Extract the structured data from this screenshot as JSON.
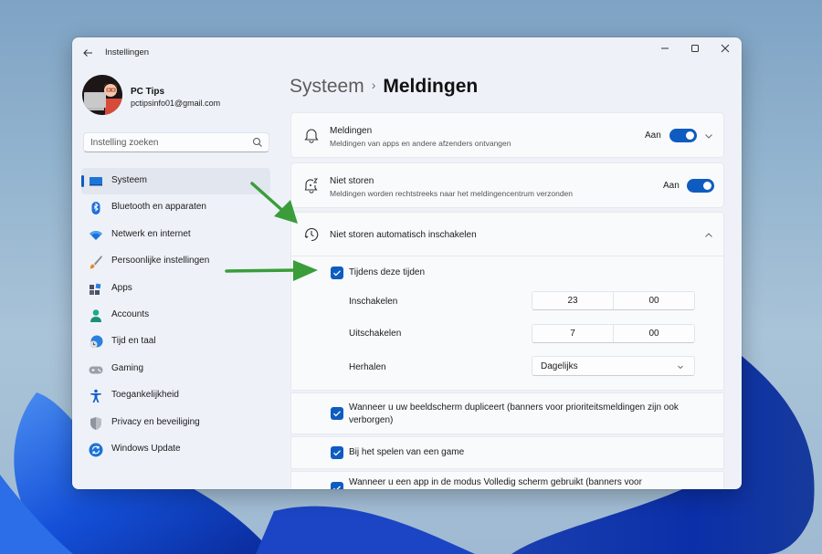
{
  "window": {
    "app_title": "Instellingen",
    "back_icon": "arrow-left-icon",
    "controls": {
      "minimize_icon": "minimize-icon",
      "maximize_icon": "maximize-icon",
      "close_icon": "close-icon"
    }
  },
  "profile": {
    "name": "PC Tips",
    "email": "pctipsinfo01@gmail.com"
  },
  "search": {
    "placeholder": "Instelling zoeken",
    "value": ""
  },
  "sidebar": {
    "items": [
      {
        "label": "Systeem",
        "icon": "monitor-icon",
        "active": true
      },
      {
        "label": "Bluetooth en apparaten",
        "icon": "bluetooth-icon",
        "active": false
      },
      {
        "label": "Netwerk en internet",
        "icon": "wifi-icon",
        "active": false
      },
      {
        "label": "Persoonlijke instellingen",
        "icon": "paintbrush-icon",
        "active": false
      },
      {
        "label": "Apps",
        "icon": "apps-icon",
        "active": false
      },
      {
        "label": "Accounts",
        "icon": "person-icon",
        "active": false
      },
      {
        "label": "Tijd en taal",
        "icon": "globe-clock-icon",
        "active": false
      },
      {
        "label": "Gaming",
        "icon": "gamepad-icon",
        "active": false
      },
      {
        "label": "Toegankelijkheid",
        "icon": "accessibility-icon",
        "active": false
      },
      {
        "label": "Privacy en beveiliging",
        "icon": "shield-icon",
        "active": false
      },
      {
        "label": "Windows Update",
        "icon": "update-icon",
        "active": false
      }
    ]
  },
  "breadcrumb": {
    "parent": "Systeem",
    "separator": "›",
    "current": "Meldingen"
  },
  "settings": {
    "notifications": {
      "title": "Meldingen",
      "subtitle": "Meldingen van apps en andere afzenders ontvangen",
      "state": "Aan",
      "enabled": true
    },
    "do_not_disturb": {
      "title": "Niet storen",
      "subtitle": "Meldingen worden rechtstreeks naar het meldingencentrum verzonden",
      "state": "Aan",
      "enabled": true
    },
    "auto_dnd": {
      "title": "Niet storen automatisch inschakelen",
      "expanded": true,
      "during_times": {
        "label": "Tijdens deze tijden",
        "checked": true
      },
      "turn_on": {
        "label": "Inschakelen",
        "hour": "23",
        "minute": "00"
      },
      "turn_off": {
        "label": "Uitschakelen",
        "hour": "7",
        "minute": "00"
      },
      "repeat": {
        "label": "Herhalen",
        "value": "Dagelijks"
      },
      "options": [
        {
          "label": "Wanneer u uw beeldscherm dupliceert (banners voor prioriteitsmeldingen zijn ook verborgen)",
          "checked": true
        },
        {
          "label": "Bij het spelen van een game",
          "checked": true
        },
        {
          "label": "Wanneer u een app in de modus Volledig scherm gebruikt (banners voor",
          "checked": true
        }
      ]
    }
  },
  "colors": {
    "accent": "#0f5cc0",
    "annotation_arrow": "#3a9d3a"
  }
}
